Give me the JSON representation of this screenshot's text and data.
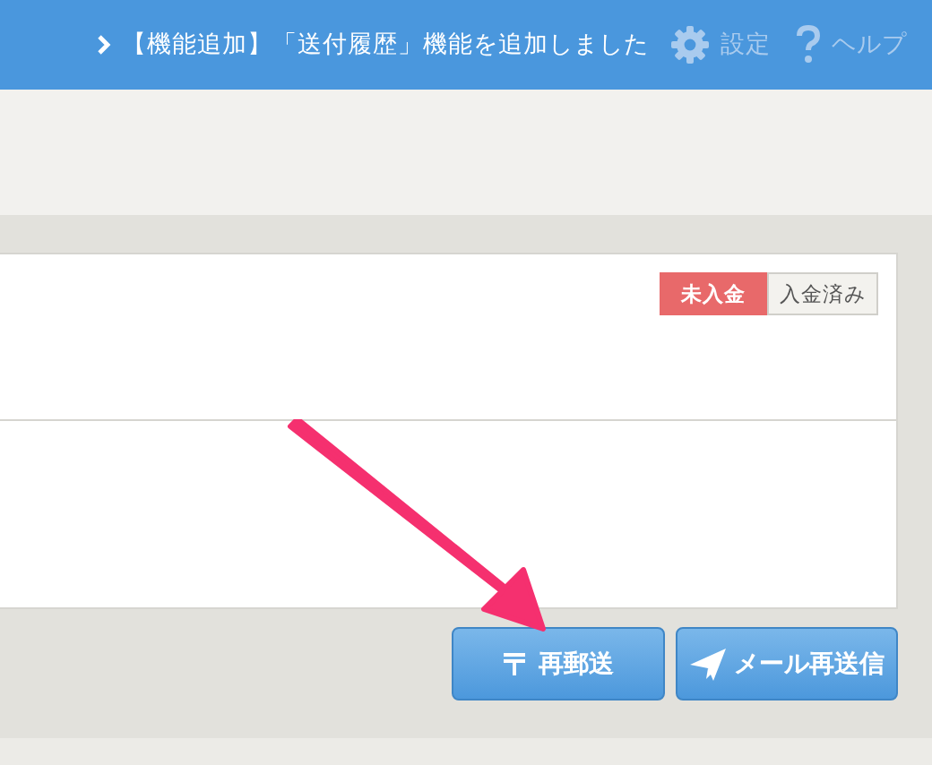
{
  "header": {
    "notice": "【機能追加】「送付履歴」機能を追加しました",
    "links": [
      {
        "kind": "settings",
        "label": "設定"
      },
      {
        "kind": "help",
        "label": "ヘルプ"
      }
    ]
  },
  "payment_toggle": [
    {
      "label": "未入金",
      "selected": true
    },
    {
      "label": "入金済み",
      "selected": false
    }
  ],
  "buttons": [
    {
      "kind": "post",
      "label": "再郵送"
    },
    {
      "kind": "mail",
      "label": "メール再送信"
    }
  ]
}
